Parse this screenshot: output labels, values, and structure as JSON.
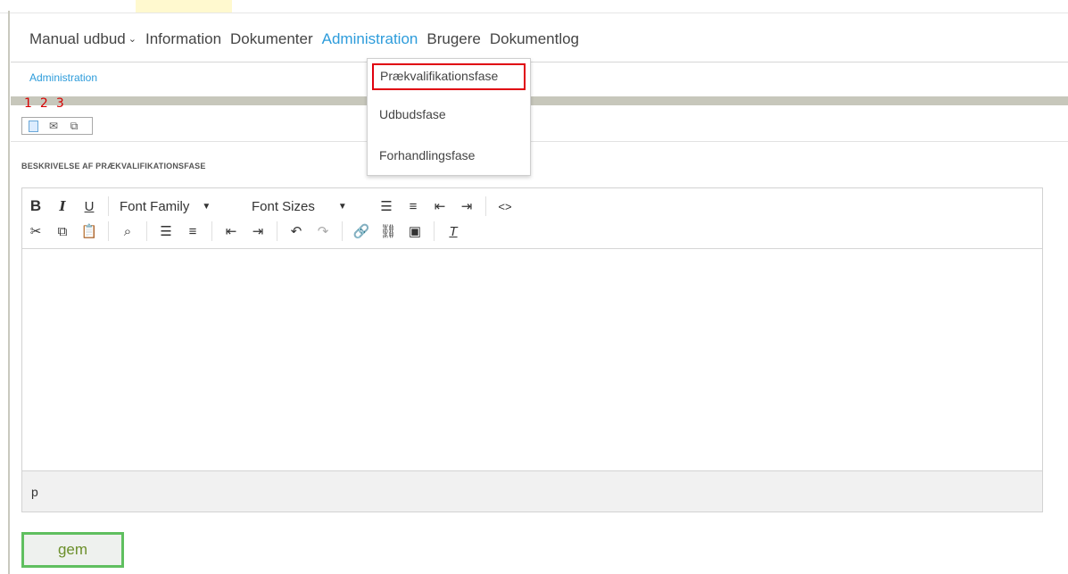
{
  "nav": {
    "items": [
      {
        "label": "Manual udbud",
        "has_chevron": true
      },
      {
        "label": "Information"
      },
      {
        "label": "Dokumenter"
      },
      {
        "label": "Administration",
        "active": true
      },
      {
        "label": "Brugere"
      },
      {
        "label": "Dokumentlog"
      }
    ],
    "active_color": "#2d9cdb"
  },
  "breadcrumb": "Administration",
  "annotations": {
    "n1": "1",
    "n2": "2",
    "n3": "3",
    "color": "#d40000"
  },
  "mini_toolbar": {
    "buttons": [
      {
        "icon": "document-icon"
      },
      {
        "icon": "envelope-icon",
        "glyph": "✉"
      },
      {
        "icon": "copy-icon",
        "glyph": "⧉"
      }
    ]
  },
  "section_title": "BESKRIVELSE AF PRÆKVALIFIKATIONSFASE",
  "editor": {
    "row1": {
      "bold": "B",
      "italic": "I",
      "underline": "U",
      "font_family": "Font Family",
      "font_sizes": "Font Sizes",
      "code": "<>"
    },
    "row2_icons": [
      "cut-icon",
      "copy-icon",
      "paste-icon",
      "find-icon",
      "bullet-list-icon",
      "numbered-list-icon",
      "outdent-icon",
      "indent-icon",
      "undo-icon",
      "redo-icon",
      "link-icon",
      "unlink-icon",
      "image-icon",
      "clear-format-icon"
    ],
    "path": "p"
  },
  "save_button": "gem",
  "dropdown": {
    "items": [
      {
        "label": "Prækvalifikationsfase",
        "highlighted": true
      },
      {
        "label": "Udbudsfase"
      },
      {
        "label": "Forhandlingsfase"
      }
    ],
    "highlight_color": "#e0000e"
  },
  "save_border_color": "#5fbf5f"
}
